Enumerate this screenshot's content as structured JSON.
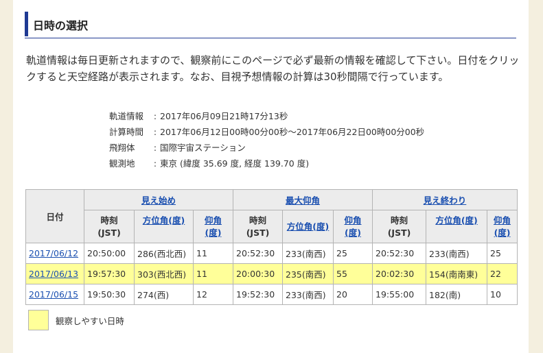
{
  "heading": {
    "title": "日時の選択"
  },
  "intro": "軌道情報は毎日更新されますので、観察前にこのページで必ず最新の情報を確認して下さい。日付をクリックすると天空経路が表示されます。なお、目視予想情報の計算は30秒間隔で行っています。",
  "meta": [
    {
      "label": "軌道情報",
      "colon": ":",
      "value": "2017年06月09日21時17分13秒"
    },
    {
      "label": "計算時間",
      "colon": ":",
      "value": "2017年06月12日00時00分00秒～2017年06月22日00時00分00秒"
    },
    {
      "label": "飛翔体",
      "colon": ":",
      "value": "国際宇宙ステーション"
    },
    {
      "label": "観測地",
      "colon": ":",
      "value": "東京 (緯度 35.69 度, 経度 139.70 度)"
    }
  ],
  "table": {
    "date_header": "日付",
    "groups": [
      "見え始め",
      "最大仰角",
      "見え終わり"
    ],
    "time_header_1": "時刻",
    "time_header_2": "(JST)",
    "azimuth_header_1": "方位角(度)",
    "azimuth_header_2": "",
    "elevation_header_1": "仰角",
    "elevation_header_2": "(度)",
    "rows": [
      {
        "date": "2017/06/12",
        "highlight": false,
        "start": {
          "time": "20:50:00",
          "az": "286(西北西)",
          "el": "11"
        },
        "max": {
          "time": "20:52:30",
          "az": "233(南西)",
          "el": "25"
        },
        "end": {
          "time": "20:52:30",
          "az": "233(南西)",
          "el": "25"
        }
      },
      {
        "date": "2017/06/13",
        "highlight": true,
        "start": {
          "time": "19:57:30",
          "az": "303(西北西)",
          "el": "11"
        },
        "max": {
          "time": "20:00:30",
          "az": "235(南西)",
          "el": "55"
        },
        "end": {
          "time": "20:02:30",
          "az": "154(南南東)",
          "el": "22"
        }
      },
      {
        "date": "2017/06/15",
        "highlight": false,
        "start": {
          "time": "19:50:30",
          "az": "274(西)",
          "el": "12"
        },
        "max": {
          "time": "19:52:30",
          "az": "233(南西)",
          "el": "20"
        },
        "end": {
          "time": "19:55:00",
          "az": "182(南)",
          "el": "10"
        }
      }
    ]
  },
  "legend": {
    "label": "観察しやすい日時",
    "color": "#ffff99"
  },
  "colors": {
    "accent": "#1f3a93",
    "link": "#1a4fb0",
    "highlight": "#ffff99",
    "background": "#f4efdf"
  }
}
